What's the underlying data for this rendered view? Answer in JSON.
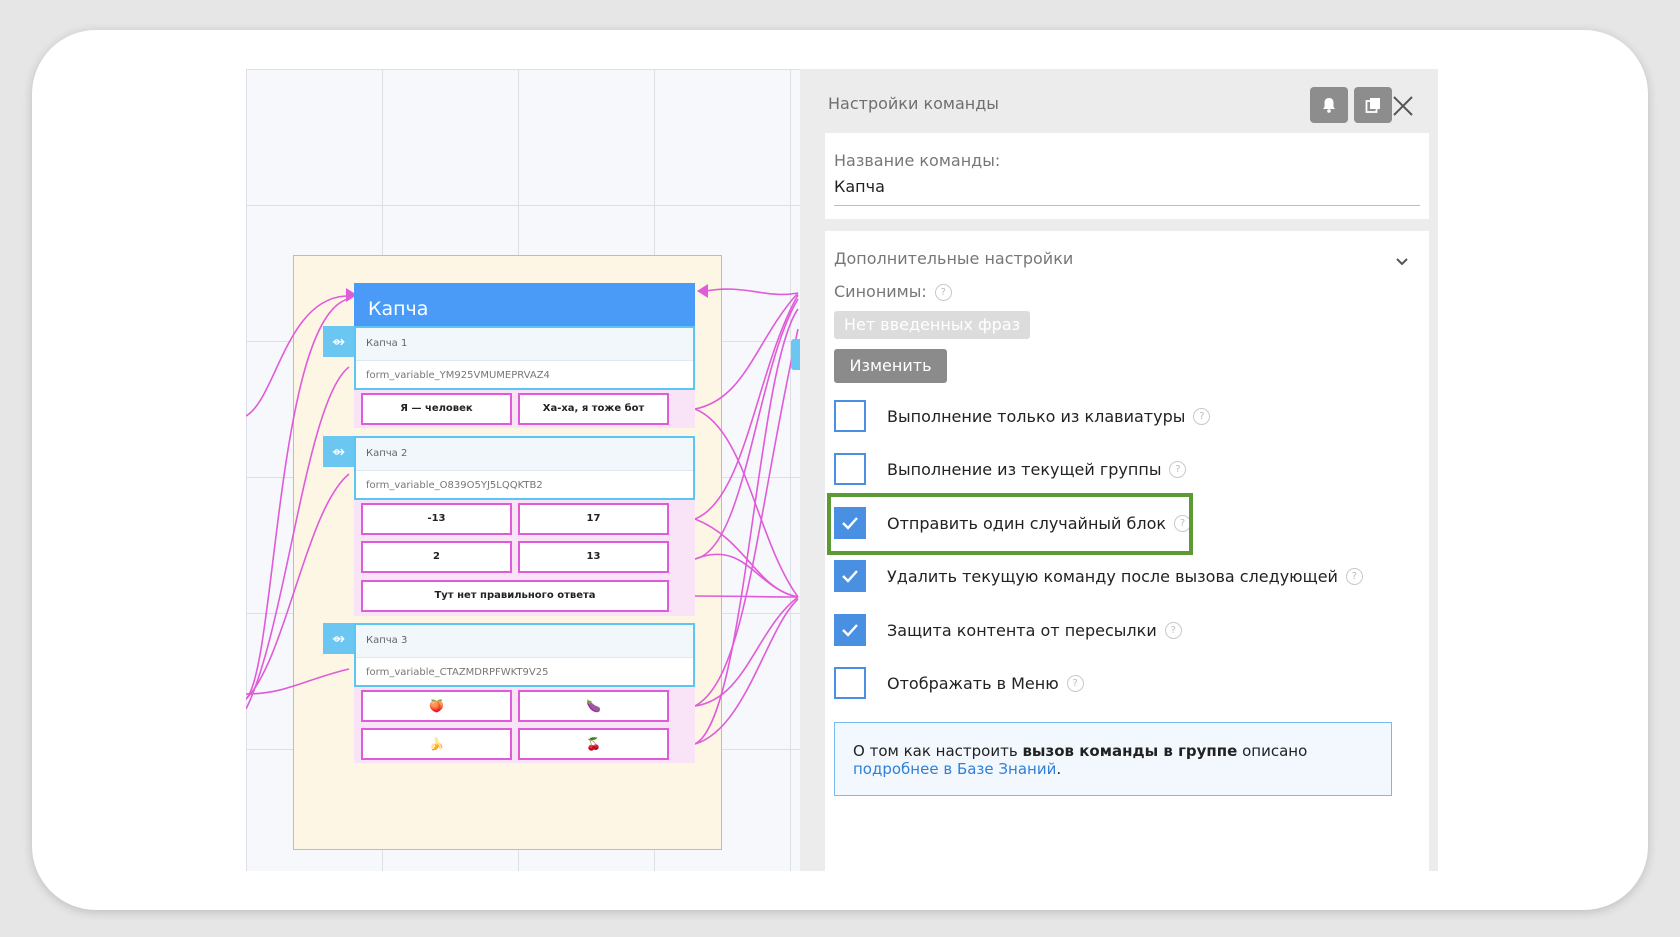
{
  "canvas": {
    "command_title": "Капча",
    "blocks": [
      {
        "title": "Капча 1",
        "variable": "form_variable_YM925VMUMEPRVAZ4",
        "answers": [
          "Я — человек",
          "Ха-ха, я тоже бот"
        ]
      },
      {
        "title": "Капча 2",
        "variable": "form_variable_O839O5YJ5LQQKTB2",
        "answers": [
          "-13",
          "17",
          "2",
          "13",
          "Тут нет правильного ответа"
        ]
      },
      {
        "title": "Капча 3",
        "variable": "form_variable_CTAZMDRPFWKT9V25",
        "answers": [
          "🍑",
          "🍆",
          "🍌",
          "🍒"
        ]
      }
    ],
    "block_icon": "form-icon",
    "colors": {
      "header": "#4a9bf7",
      "block_border": "#5bc5f5",
      "answer_border": "#e05bd9",
      "link": "#e05bd9",
      "group_border": "#efb462"
    }
  },
  "panel": {
    "title": "Настройки команды",
    "toolbar": {
      "notify_icon": "bell-icon",
      "copy_icon": "copy-icon",
      "close_icon": "close-icon"
    },
    "name_card": {
      "label": "Название команды:",
      "value": "Капча"
    },
    "advanced": {
      "title": "Дополнительные настройки",
      "synonyms_label": "Синонимы:",
      "synonyms_empty": "Нет введенных фраз",
      "change_button": "Изменить",
      "options": [
        {
          "label": "Выполнение только из клавиатуры",
          "checked": false
        },
        {
          "label": "Выполнение из текущей группы",
          "checked": false
        },
        {
          "label": "Отправить один случайный блок",
          "checked": true
        },
        {
          "label": "Удалить текущую команду после вызова следующей",
          "checked": true
        },
        {
          "label": "Защита контента от пересылки",
          "checked": true
        },
        {
          "label": "Отображать в Меню",
          "checked": false
        }
      ],
      "info": {
        "prefix": "О том как настроить ",
        "bold": "вызов команды в группе",
        "middle": " описано ",
        "link": "подробнее в Базе Знаний",
        "suffix": "."
      }
    },
    "accent_color": "#4a90e2",
    "highlight_color": "#5b9a34"
  }
}
